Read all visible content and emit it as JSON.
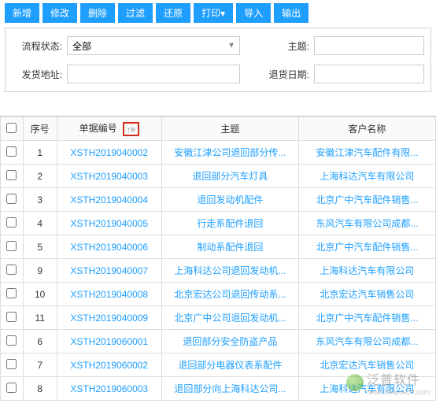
{
  "toolbar": {
    "buttons": [
      {
        "id": "new",
        "label": "新增"
      },
      {
        "id": "edit",
        "label": "修改"
      },
      {
        "id": "delete",
        "label": "删除"
      },
      {
        "id": "filter",
        "label": "过滤"
      },
      {
        "id": "restore",
        "label": "还原"
      },
      {
        "id": "print",
        "label": "打印▾"
      },
      {
        "id": "import",
        "label": "导入"
      },
      {
        "id": "export",
        "label": "输出"
      }
    ]
  },
  "filters": {
    "status_label": "流程状态:",
    "status_value": "全部",
    "subject_label": "主题:",
    "subject_value": "",
    "ship_addr_label": "发货地址:",
    "ship_addr_value": "",
    "return_date_label": "退货日期:",
    "return_date_value": ""
  },
  "table": {
    "headers": {
      "seq": "序号",
      "doc_no": "单据编号",
      "subject": "主题",
      "customer": "客户名称"
    },
    "rows": [
      {
        "seq": "1",
        "doc_no": "XSTH2019040002",
        "subject": "安徽江津公司退回部分传...",
        "customer": "安徽江津汽车配件有限..."
      },
      {
        "seq": "2",
        "doc_no": "XSTH2019040003",
        "subject": "退回部分汽车灯具",
        "customer": "上海科达汽车有限公司"
      },
      {
        "seq": "3",
        "doc_no": "XSTH2019040004",
        "subject": "退回发动机配件",
        "customer": "北京广中汽车配件销售..."
      },
      {
        "seq": "4",
        "doc_no": "XSTH2019040005",
        "subject": "行走系配件退回",
        "customer": "东风汽车有限公司成都..."
      },
      {
        "seq": "5",
        "doc_no": "XSTH2019040006",
        "subject": "制动系配件退回",
        "customer": "北京广中汽车配件销售..."
      },
      {
        "seq": "9",
        "doc_no": "XSTH2019040007",
        "subject": "上海科达公司退回发动机...",
        "customer": "上海科达汽车有限公司"
      },
      {
        "seq": "10",
        "doc_no": "XSTH2019040008",
        "subject": "北京宏达公司退回传动系...",
        "customer": "北京宏达汽车销售公司"
      },
      {
        "seq": "11",
        "doc_no": "XSTH2019040009",
        "subject": "北京广中公司退回发动机...",
        "customer": "北京广中汽车配件销售..."
      },
      {
        "seq": "6",
        "doc_no": "XSTH2019060001",
        "subject": "退回部分安全防盗产品",
        "customer": "东风汽车有限公司成都..."
      },
      {
        "seq": "7",
        "doc_no": "XSTH2019060002",
        "subject": "退回部分电器仪表系配件",
        "customer": "北京宏达汽车销售公司"
      },
      {
        "seq": "8",
        "doc_no": "XSTH2019060003",
        "subject": "退回部分向上海科达公司...",
        "customer": "上海科达汽车有限公司"
      }
    ]
  },
  "watermark": {
    "brand": "泛普软件",
    "url": "www.fanpusoft.com"
  }
}
